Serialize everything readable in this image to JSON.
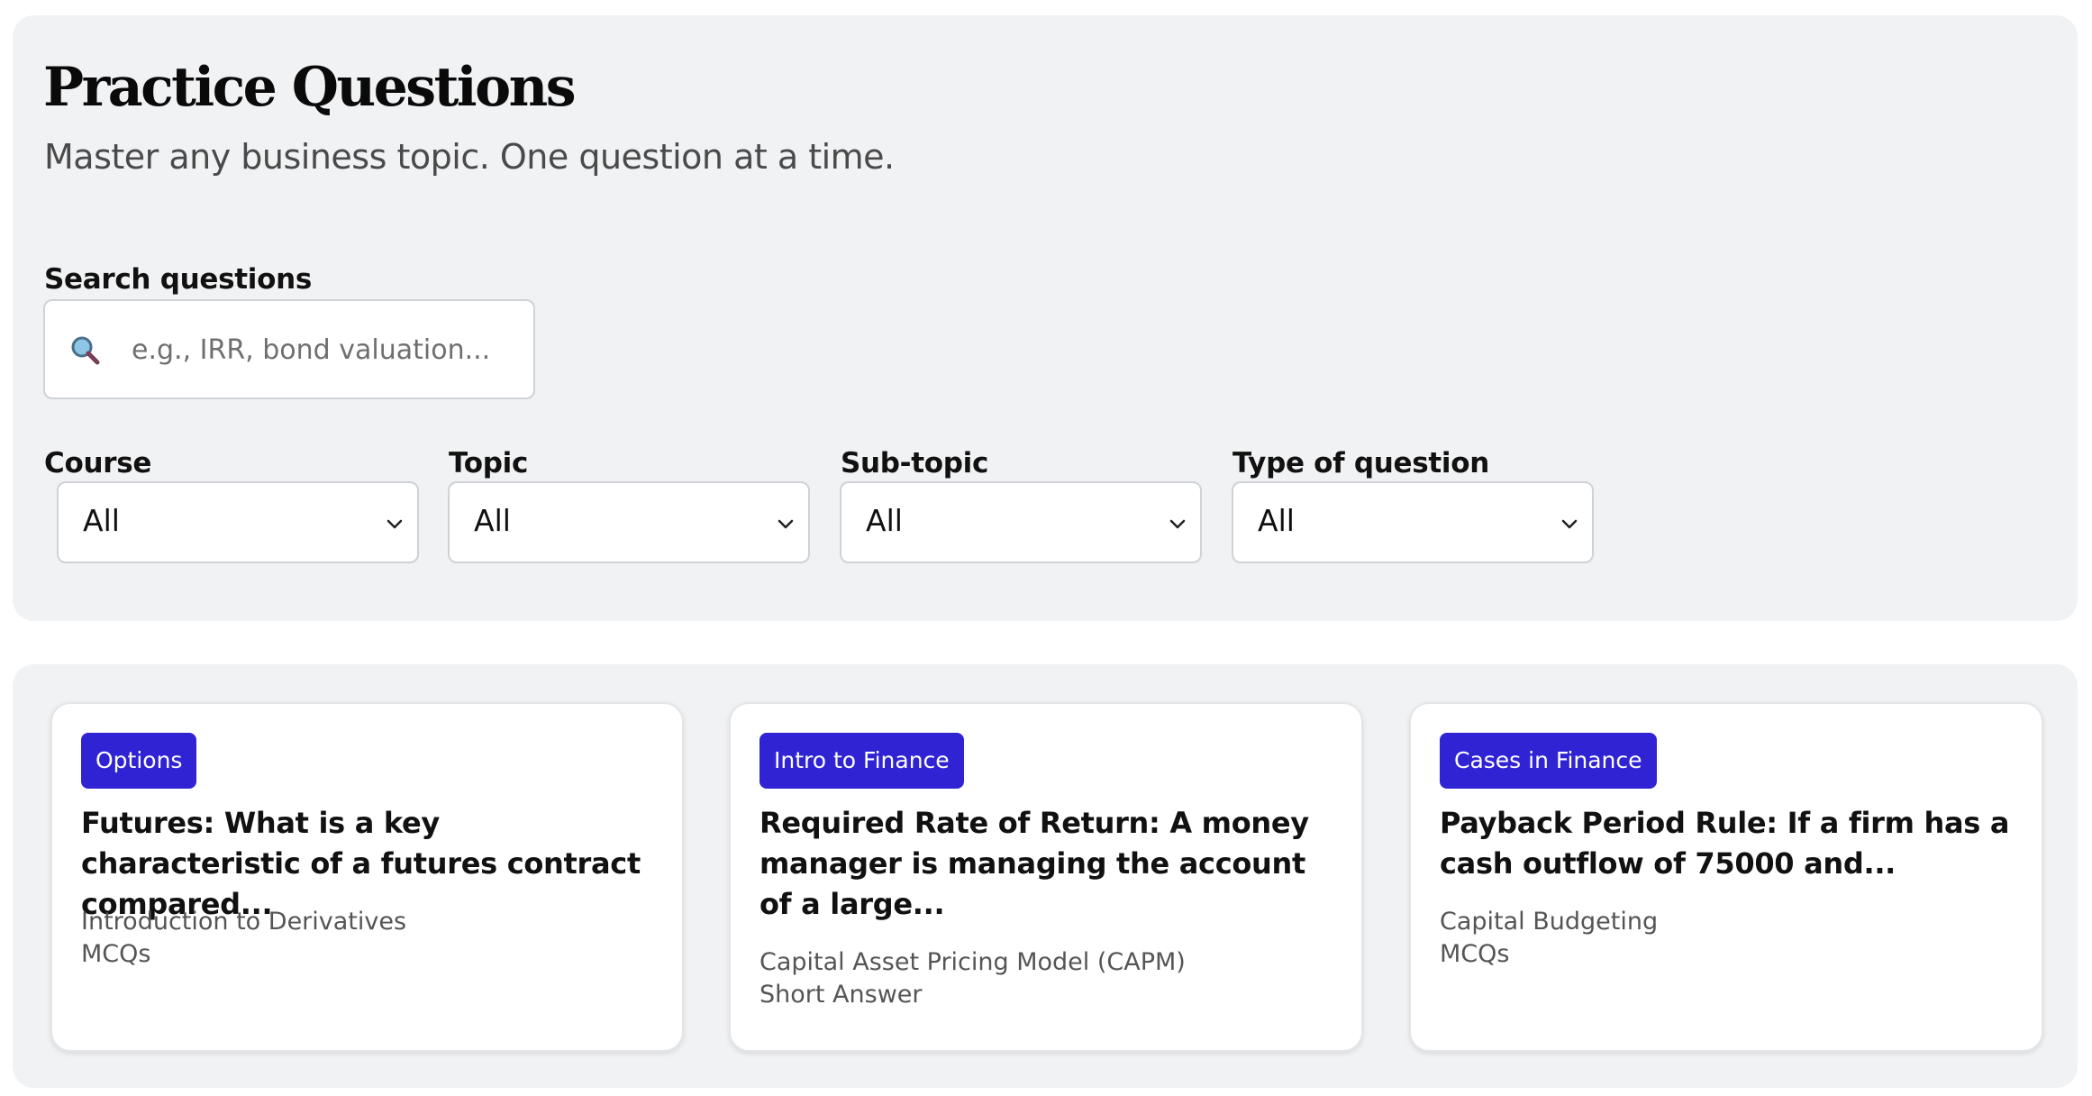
{
  "header": {
    "title": "Practice Questions",
    "subtitle": "Master any business topic. One question at a time."
  },
  "search": {
    "label": "Search questions",
    "placeholder": "e.g., IRR, bond valuation...",
    "value": "",
    "icon": "search-icon"
  },
  "filters": [
    {
      "label": "Course",
      "value": "All"
    },
    {
      "label": "Topic",
      "value": "All"
    },
    {
      "label": "Sub-topic",
      "value": "All"
    },
    {
      "label": "Type of question",
      "value": "All"
    }
  ],
  "cards": [
    {
      "badge": "Options",
      "title": "Futures: What is a key characteristic of a futures contract compared...",
      "subtopic": "Introduction to Derivatives",
      "type": "MCQs"
    },
    {
      "badge": "Intro to Finance",
      "title": "Required Rate of Return: A money manager is managing the account of a large...",
      "subtopic": "Capital Asset Pricing Model (CAPM)",
      "type": "Short Answer"
    },
    {
      "badge": "Cases in Finance",
      "title": "Payback Period Rule: If a firm has a cash outflow of 75000 and...",
      "subtopic": "Capital Budgeting",
      "type": "MCQs"
    }
  ],
  "colors": {
    "badge": "#2f23d4",
    "panel": "#f1f2f4"
  }
}
